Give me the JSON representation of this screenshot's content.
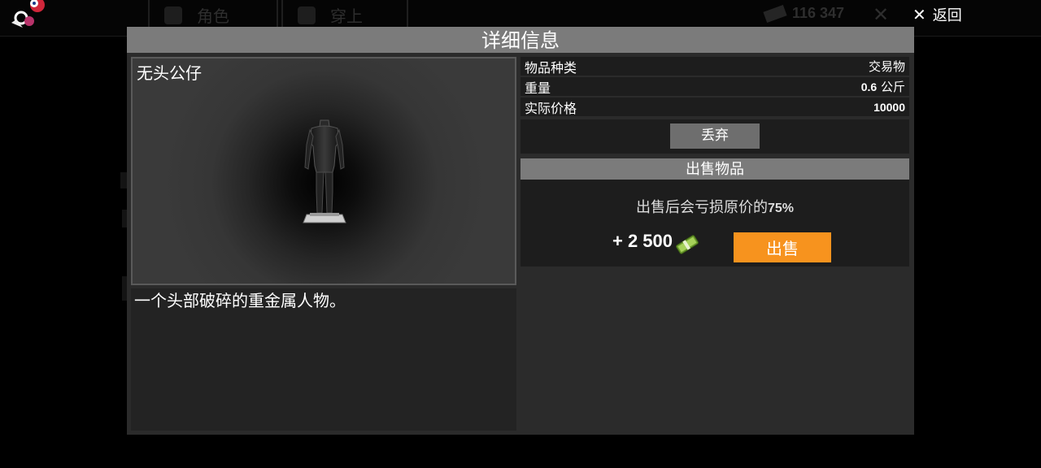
{
  "background": {
    "tabs": [
      {
        "label": "角色"
      },
      {
        "label": "穿上"
      }
    ],
    "money": "116 347"
  },
  "back": {
    "label": "返回"
  },
  "dialog": {
    "title": "详细信息",
    "item": {
      "name": "无头公仔",
      "description": "一个头部破碎的重金属人物。"
    },
    "properties": [
      {
        "label": "物品种类",
        "value": "交易物"
      },
      {
        "label": "重量",
        "value_num": "0.6",
        "value_unit": "公斤"
      },
      {
        "label": "实际价格",
        "value": "10000"
      }
    ],
    "discard_label": "丢弃",
    "sell": {
      "header": "出售物品",
      "note_prefix": "出售后会亏损原价的",
      "note_percent": "75%",
      "amount": "+ 2 500",
      "button_label": "出售"
    }
  },
  "colors": {
    "accent": "#f7931e",
    "header_gray": "#7b7b7b",
    "panel": "#2b2b2b"
  }
}
